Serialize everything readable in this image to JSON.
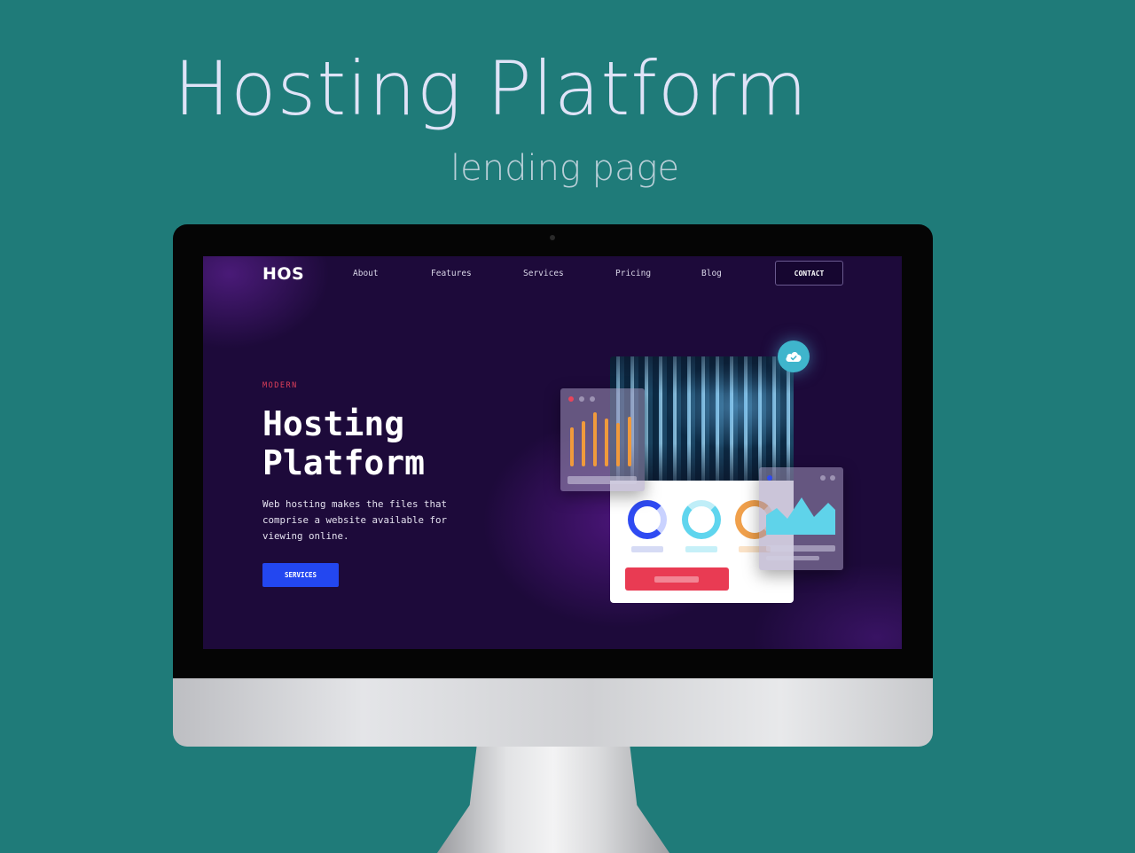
{
  "presentation": {
    "title": "Hosting Platform",
    "subtitle": "lending page"
  },
  "site": {
    "logo": "HOS",
    "nav": {
      "about": "About",
      "features": "Features",
      "services": "Services",
      "pricing": "Pricing",
      "blog": "Blog"
    },
    "contact_label": "CONTACT",
    "hero": {
      "eyebrow": "MODERN",
      "title": "Hosting Platform",
      "description": "Web hosting makes the files that comprise a website available for viewing online.",
      "cta_label": "SERVICES"
    }
  },
  "colors": {
    "background": "#1f7b79",
    "screen_bg": "#1d0a3a",
    "accent_blue": "#2347f0",
    "accent_red": "#e93b53",
    "accent_orange": "#f09a3c",
    "accent_cyan": "#3fb5cc"
  },
  "icons": {
    "cloud_badge": "cloud-check-icon"
  }
}
